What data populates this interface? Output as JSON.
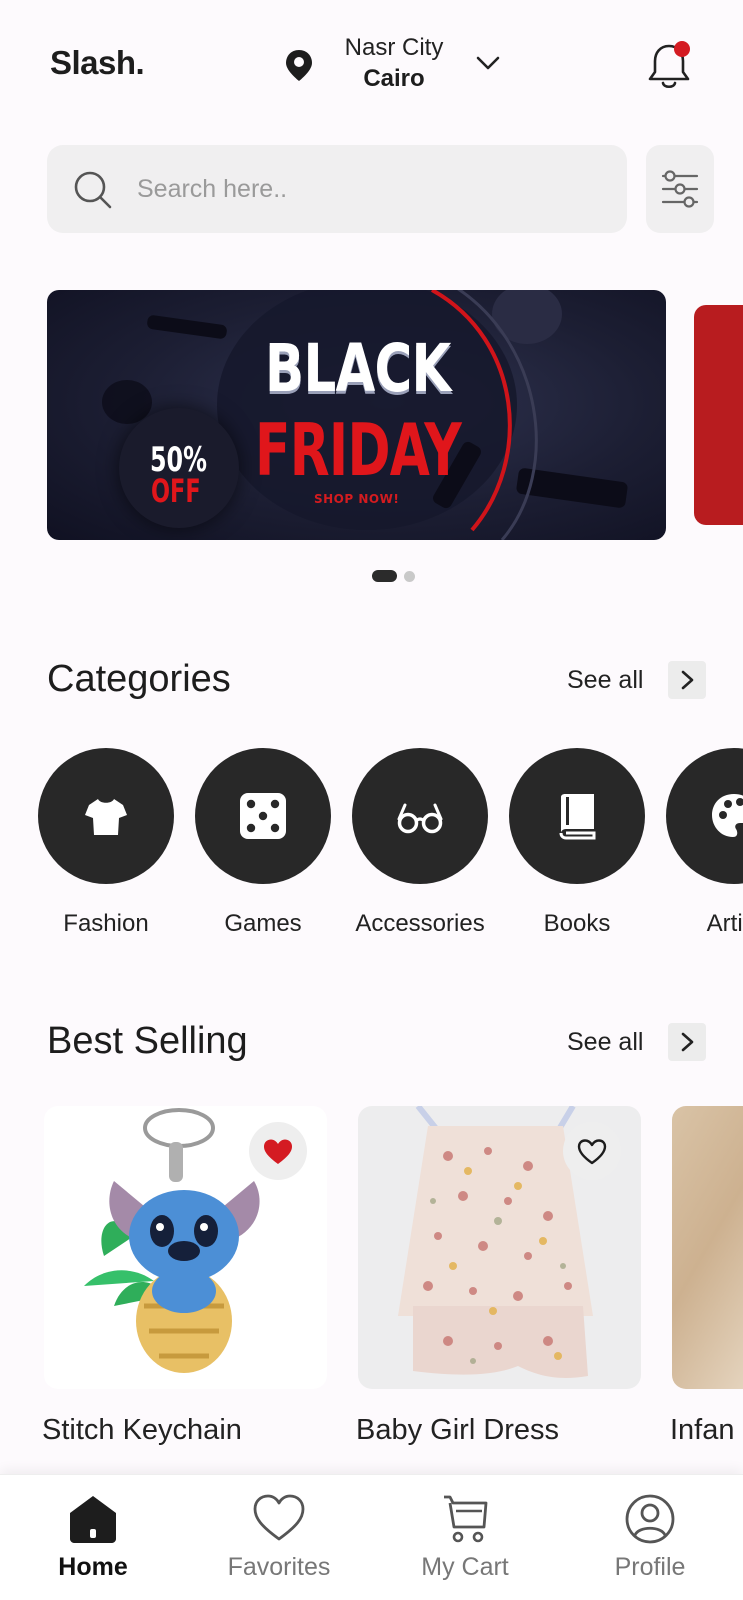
{
  "header": {
    "logo": "Slash.",
    "location_city": "Nasr City",
    "location_region": "Cairo"
  },
  "search": {
    "placeholder": "Search here.."
  },
  "banner": {
    "line1": "BLACK",
    "line2": "FRIDAY",
    "cta": "SHOP NOW!",
    "discount_pct": "50%",
    "discount_off": "OFF",
    "slide_count": 2,
    "active_slide": 1
  },
  "categories": {
    "title": "Categories",
    "see_all": "See all",
    "items": [
      {
        "label": "Fashion",
        "icon": "tshirt-icon"
      },
      {
        "label": "Games",
        "icon": "dice-icon"
      },
      {
        "label": "Accessories",
        "icon": "glasses-icon"
      },
      {
        "label": "Books",
        "icon": "book-icon"
      },
      {
        "label": "Artifc",
        "icon": "palette-icon"
      }
    ]
  },
  "best_selling": {
    "title": "Best Selling",
    "see_all": "See all",
    "items": [
      {
        "name": "Stitch Keychain",
        "favorited": true
      },
      {
        "name": "Baby Girl Dress",
        "favorited": false
      },
      {
        "name": "Infan",
        "favorited": false
      }
    ]
  },
  "bottom_nav": {
    "items": [
      {
        "label": "Home",
        "icon": "home-icon",
        "active": true
      },
      {
        "label": "Favorites",
        "icon": "heart-icon",
        "active": false
      },
      {
        "label": "My Cart",
        "icon": "cart-icon",
        "active": false
      },
      {
        "label": "Profile",
        "icon": "user-icon",
        "active": false
      }
    ]
  },
  "colors": {
    "accent_red": "#d41b22",
    "dark": "#282828",
    "background": "#fdfafd"
  }
}
